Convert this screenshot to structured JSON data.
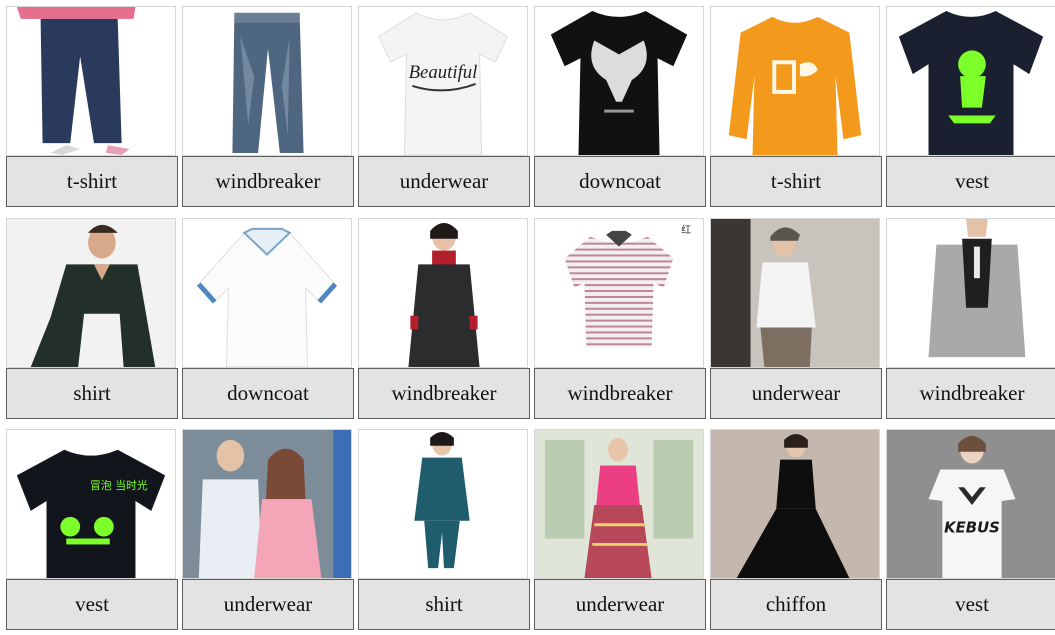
{
  "rows": [
    {
      "tiles": [
        {
          "label": "t-shirt"
        },
        {
          "label": "windbreaker"
        },
        {
          "label": "underwear",
          "print_text": "Beautiful"
        },
        {
          "label": "downcoat"
        },
        {
          "label": "t-shirt"
        },
        {
          "label": "vest"
        }
      ]
    },
    {
      "tiles": [
        {
          "label": "shirt"
        },
        {
          "label": "downcoat"
        },
        {
          "label": "windbreaker"
        },
        {
          "label": "windbreaker"
        },
        {
          "label": "underwear"
        },
        {
          "label": "windbreaker"
        }
      ]
    },
    {
      "tiles": [
        {
          "label": "vest"
        },
        {
          "label": "underwear"
        },
        {
          "label": "shirt"
        },
        {
          "label": "underwear"
        },
        {
          "label": "chiffon"
        },
        {
          "label": "vest",
          "print_text": "KEBUS"
        }
      ]
    }
  ]
}
